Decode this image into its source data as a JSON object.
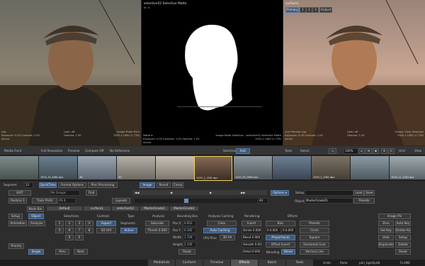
{
  "viewers": {
    "left": {
      "bottom_left_top": "Log",
      "bottom_left_mid": "Exposure: 0.00   Contrast: 1.00",
      "bottom_left_bot": "Active",
      "bottom_mid_top": "Look: off",
      "bottom_mid_bot": "Gamma: 1.00",
      "bottom_right_top": "Image Photo Print",
      "bottom_right_bot": "1920 x 1080 (1.778)"
    },
    "center": {
      "title": "selective52 Selective Matte",
      "subtitle": "kr: 3",
      "bottom_left_top": "Matte ▾",
      "bottom_left_mid": "Exposure: 0.00   Contrast: 1.00   Gamma: 1.00",
      "bottom_left_bot": "Active",
      "bottom_right_top": "Image Node Selective - selective52 Selective Matte",
      "bottom_right_bot": "1920 x 1080 (1.778)"
    },
    "right": {
      "title": "surface1",
      "tabs": [
        "Primary",
        "1",
        "2",
        "3",
        "Output"
      ],
      "bottom_left_top": "Live Preview   Log",
      "bottom_left_mid": "Exposure: 0.00   Contrast: 1.00",
      "bottom_left_bot": "Active",
      "bottom_mid_top": "Look: off",
      "bottom_mid_bot": "Gamma: 1.00",
      "bottom_right_top": "Output: Zero Selective",
      "bottom_right_bot": "1920 x 1080 (1.778)"
    }
  },
  "toolbar": {
    "media_front": "Media Front",
    "full_resolution": "Full Resolution",
    "preview": "Preview",
    "compare": "Compare Off",
    "no_reference": "No Reference",
    "selective_label": "Selective",
    "selective_value": "Axis",
    "tools_label": "Tools",
    "tools_value": "Select",
    "zoom": "100%",
    "grid": "Grid",
    "view": "View"
  },
  "thumbs": [
    {
      "label": ""
    },
    {
      "label": "1024_15_4881.dpx"
    },
    {
      "label": "3D"
    },
    {
      "label": "3D"
    },
    {
      "label": ""
    },
    {
      "label": "1029_1_1581.dpx"
    },
    {
      "label": "1020_05_3689.dpx"
    },
    {
      "label": ""
    },
    {
      "label": "1029_1_1581.dpx"
    },
    {
      "label": ""
    },
    {
      "label": "1026_11_1083.dpx"
    }
  ],
  "row1": {
    "segment": "Segment",
    "segment_val": "13",
    "quicktime": "QuickTime",
    "format_options": "Format Options",
    "proc_processing": "Proc Processing",
    "image": "Image",
    "result": "Result",
    "comp": "Comp"
  },
  "row2": {
    "exit": "EXIT",
    "no_groups": "No Groups",
    "find": "Find",
    "setup_label": "Setup",
    "load": "Load",
    "save": "Save"
  },
  "row3": {
    "restore": "Restore",
    "restore_val": "1",
    "track_prefs": "Track Prefs",
    "track_val": "F1.1",
    "layouts": "Layouts",
    "frame": "44",
    "object_label": "Object",
    "object_value": "MasterGrade01",
    "presets": "Presets"
  },
  "row4": {
    "node_bin": "Node Bin",
    "default": "Default",
    "surface1": "surface1",
    "selective52": "selective52",
    "mastergrade1": "MasterGrade1",
    "mastergrade2": "MasterGrade1"
  },
  "left_panel": {
    "setup": "Setup",
    "object": "Object",
    "selections": "Selections",
    "controls": "Controls",
    "type": "Type",
    "animation": "Animation",
    "analyzer": "Analyzer",
    "aspect": "Aspect",
    "segments": "Segments",
    "surface": "SD H/V",
    "active": "Active",
    "priority": "Priority",
    "single": "Single",
    "prev": "Prev",
    "next": "Next",
    "keypad": [
      "1",
      "2",
      "3",
      "4",
      "5",
      "6",
      "7",
      "8",
      "9",
      "0"
    ]
  },
  "analysis": {
    "title": "Analysis",
    "saturation": "Saturate",
    "threshold": "Thresh 0.000"
  },
  "bounding": {
    "title": "Bounding Box",
    "pos_x_lbl": "Pos X",
    "pos_x": "0.953",
    "pos_y_lbl": "Pos Y",
    "pos_y": "0.192",
    "width_lbl": "Width",
    "width": "1.729",
    "height_lbl": "Height",
    "height": "2.150",
    "reset": "Reset"
  },
  "caching": {
    "title": "Analysis Caching",
    "clear": "Clear",
    "auto": "Auto Caching",
    "cpu_lbl": "CPU Prox",
    "cpu_val": "3D AA"
  },
  "rendering": {
    "title": "Rendering",
    "invert": "Invert",
    "shrink": "Shrink 0.000",
    "blend": "Blend 0.000",
    "smooth": "Smooth 0.000",
    "detail": "Detail 0.000"
  },
  "effects": {
    "title": "Effects",
    "blur": "Blur",
    "val1": "0.0.000",
    "val2": "0.0.000",
    "proportional": "Proportional",
    "offset_invert": "Offset Invert",
    "blending_lbl": "Blending",
    "blending_val": "Blend",
    "presets": "Presets",
    "circle": "Circle",
    "square": "Square",
    "horizontal": "Horizontal Line",
    "vertical": "Vertical Line"
  },
  "image_pin": {
    "title": "Image Pin",
    "rows": [
      [
        "Zero",
        "Auto Key"
      ],
      [
        "Set Key",
        "Delete Key"
      ],
      [
        "Hide",
        "Setup"
      ],
      [
        "Duplicate",
        "Delete"
      ],
      [
        "",
        "Reset"
      ]
    ]
  },
  "bottom_tabs": [
    "MediaHub",
    "Conform",
    "Timeline",
    "Effects",
    "Batch",
    "Tools"
  ],
  "bottom_right": {
    "undo": "Undo",
    "redo": "Redo",
    "project": "pah_bgeOpd8",
    "flame": "FLAME"
  },
  "colors": {
    "accent": "#3e5a7c",
    "selected_thumb": "#f2d45a",
    "tab_active": "#555555"
  }
}
